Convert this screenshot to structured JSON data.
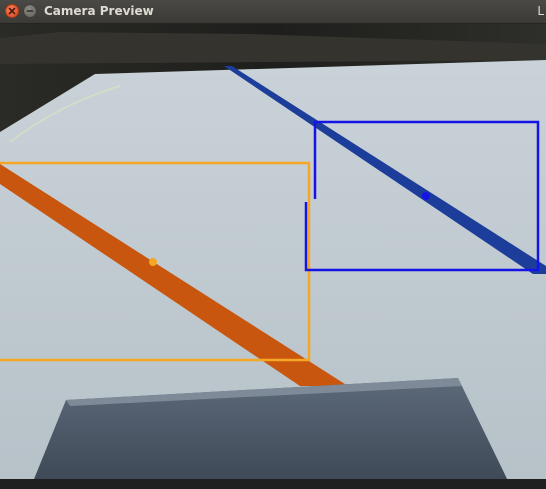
{
  "window": {
    "title": "Camera Preview",
    "edge_text": "L"
  },
  "icons": {
    "close": "close-icon",
    "minimize": "minimize-icon"
  },
  "overlays": {
    "orange_color": "#f5a623",
    "blue_color": "#1414e6",
    "orange_tape_color": "#c8560e",
    "blue_tape_color": "#1c3d9a"
  }
}
